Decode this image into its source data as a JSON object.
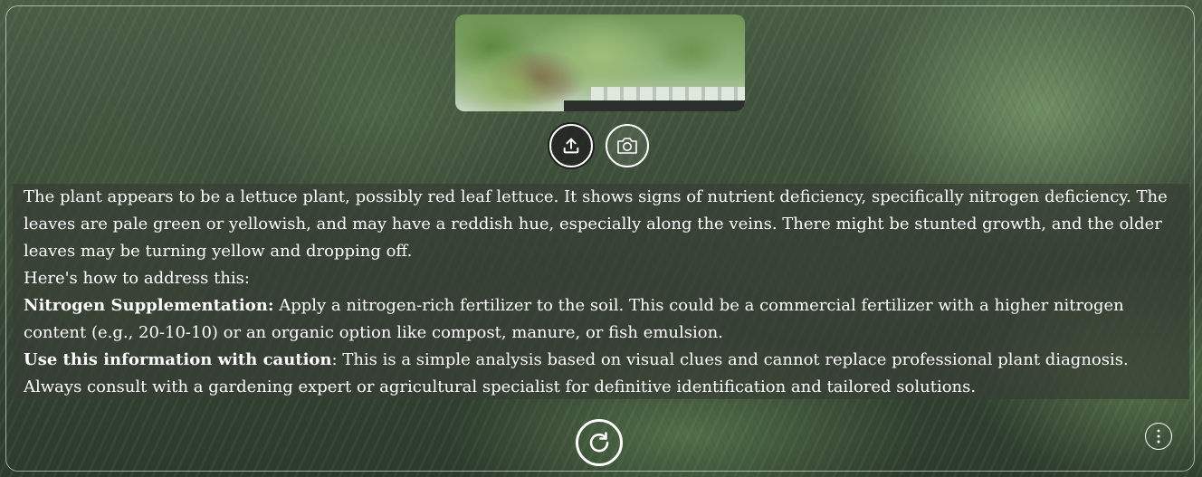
{
  "toolbar": {
    "upload_icon": "upload-icon",
    "camera_icon": "camera-icon",
    "reload_icon": "reload-icon",
    "menu_icon": "more-vertical-icon"
  },
  "result": {
    "diagnosis": "The plant appears to be a lettuce plant, possibly red leaf lettuce. It shows signs of nutrient deficiency, specifically nitrogen deficiency. The leaves are pale green or yellowish, and may have a reddish hue, especially along the veins. There might be stunted growth, and the older leaves may be turning yellow and dropping off.",
    "intro": "Here's how to address this:",
    "recommendation_title": "Nitrogen Supplementation:",
    "recommendation_text": " Apply a nitrogen-rich fertilizer to the soil. This could be a commercial fertilizer with a higher nitrogen content (e.g., 20-10-10) or an organic option like compost, manure, or fish emulsion.",
    "caution_title": "Use this information with caution",
    "caution_text": ": This is a simple analysis based on visual clues and cannot replace professional plant diagnosis. Always consult with a gardening expert or agricultural specialist for definitive identification and tailored solutions."
  },
  "colors": {
    "panel_bg": "#373e34",
    "text": "#ffffff",
    "button_border": "#ffffff"
  }
}
